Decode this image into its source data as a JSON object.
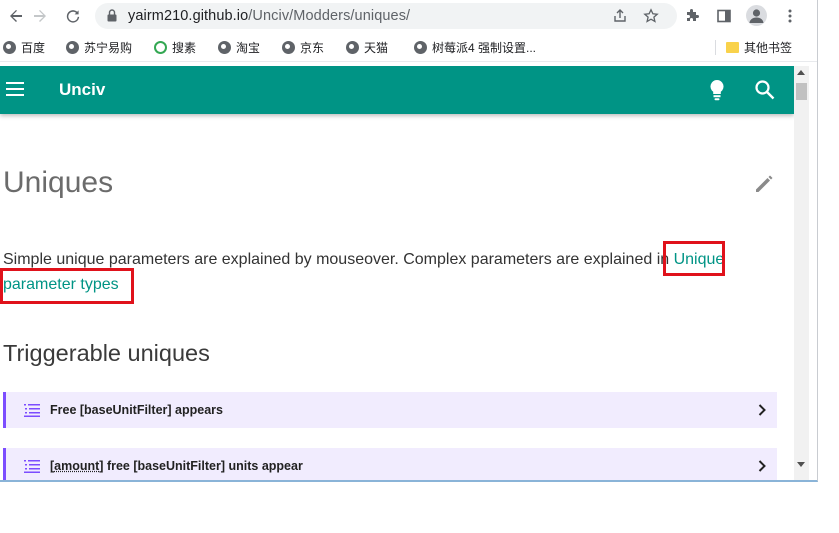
{
  "browser": {
    "url_host": "yairm210.github.io",
    "url_path": "/Unciv/Modders/uniques/",
    "bookmarks": [
      {
        "label": "百度"
      },
      {
        "label": "苏宁易购"
      },
      {
        "label": "搜素"
      },
      {
        "label": "淘宝"
      },
      {
        "label": "京东"
      },
      {
        "label": "天猫"
      },
      {
        "label": "树莓派4 强制设置..."
      }
    ],
    "other_bookmarks": "其他书签"
  },
  "site": {
    "title": "Unciv",
    "accent_color": "#009485"
  },
  "page": {
    "title": "Uniques",
    "intro_text": "Simple unique parameters are explained by mouseover. Complex parameters are explained in ",
    "intro_link": "Unique parameter types",
    "section_title": "Triggerable uniques",
    "admonitions": [
      {
        "prefix": "",
        "text": "Free [baseUnitFilter] appears"
      },
      {
        "prefix": "[amount]",
        "text": " free [baseUnitFilter] units appear"
      }
    ]
  }
}
